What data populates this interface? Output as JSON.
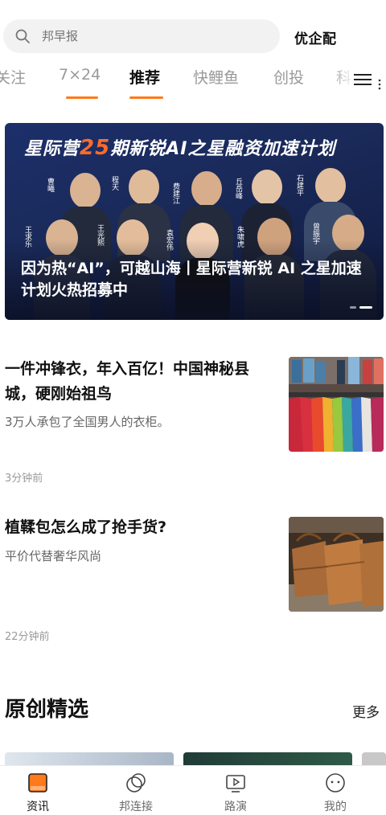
{
  "search": {
    "placeholder": "邦早报",
    "brand": "优企配"
  },
  "tabs": [
    {
      "label": "关注",
      "active": false
    },
    {
      "label": "7×24",
      "active": false
    },
    {
      "label": "推荐",
      "active": true
    },
    {
      "label": "快鲤鱼",
      "active": false
    },
    {
      "label": "创投",
      "active": false
    },
    {
      "label": "科",
      "active": false
    }
  ],
  "tab_icons": [
    "menu-icon",
    "more-dots-icon"
  ],
  "accent_color": "#ff7a1a",
  "banner": {
    "title_prefix": "星际营",
    "title_number": "25",
    "title_suffix": "期新锐AI之星融资加速计划",
    "caption": "因为热“AI”，可越山海丨星际营新锐 AI 之星加速计划火热招募中",
    "speakers": [
      "曹曦",
      "程天",
      "费建江",
      "丘岳峰",
      "石建平",
      "王求乐",
      "王光熙",
      "袁宏伟",
      "朱啸虎",
      "曾振宇"
    ]
  },
  "news": [
    {
      "title": "一件冲锋衣，年入百亿！中国神秘县城，硬刚始祖鸟",
      "subtitle": "3万人承包了全国男人的衣柜。",
      "time": "3分钟前",
      "thumb": "jackets-rack-image"
    },
    {
      "title": "植鞣包怎么成了抢手货?",
      "subtitle": "平价代替奢华风尚",
      "time": "22分钟前",
      "thumb": "leather-bags-image"
    }
  ],
  "section": {
    "title": "原创精选",
    "more": "更多"
  },
  "bottom_nav": [
    {
      "label": "资讯",
      "icon": "news-icon",
      "active": true
    },
    {
      "label": "邦连接",
      "icon": "connect-icon",
      "active": false
    },
    {
      "label": "路演",
      "icon": "roadshow-icon",
      "active": false
    },
    {
      "label": "我的",
      "icon": "profile-icon",
      "active": false
    }
  ]
}
